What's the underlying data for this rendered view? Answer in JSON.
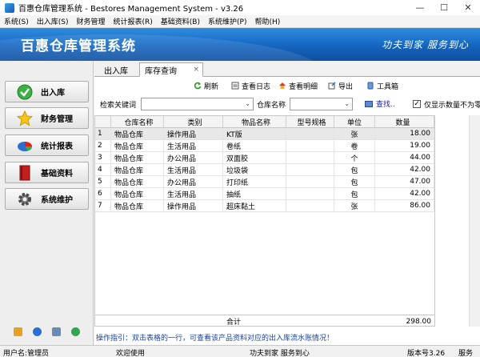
{
  "window": {
    "title": "百惠仓库管理系统 - Bestores Management System - v3.26",
    "controls": [
      "—",
      "☐",
      "✕"
    ]
  },
  "menu": [
    "系统(S)",
    "出入库(S)",
    "财务管理",
    "统计报表(R)",
    "基础资料(B)",
    "系统维护(P)",
    "帮助(H)"
  ],
  "banner": {
    "title": "百惠仓库管理系统",
    "slogan": "功夫到家 服务到心"
  },
  "sidebar": {
    "items": [
      {
        "label": "出入库",
        "icon": "check-circle-icon"
      },
      {
        "label": "财务管理",
        "icon": "star-icon"
      },
      {
        "label": "统计报表",
        "icon": "pie-chart-icon"
      },
      {
        "label": "基础资料",
        "icon": "book-icon"
      },
      {
        "label": "系统维护",
        "icon": "gear-icon"
      }
    ]
  },
  "tabs": {
    "in_out": "出入库",
    "stock_query": "库存查询",
    "close": "×"
  },
  "toolbar": {
    "refresh": "刷新",
    "view_log": "查看日志",
    "view_detail": "查看明细",
    "export": "导出",
    "toolbox": "工具箱"
  },
  "search": {
    "keyword_label": "检索关键词",
    "keyword_value": "",
    "warehouse_label": "仓库名称",
    "warehouse_value": "",
    "find_label": "查找..",
    "only_nonzero_label": "仅显示数量不为零",
    "only_nonzero_checked": "✓"
  },
  "table": {
    "headers": [
      "",
      "仓库名称",
      "类别",
      "物品名称",
      "型号规格",
      "单位",
      "数量"
    ],
    "rows": [
      [
        "1",
        "物品仓库",
        "操作用品",
        "KT版",
        "",
        "张",
        "18.00"
      ],
      [
        "2",
        "物品仓库",
        "生活用品",
        "卷纸",
        "",
        "卷",
        "19.00"
      ],
      [
        "3",
        "物品仓库",
        "办公用品",
        "双面胶",
        "",
        "个",
        "44.00"
      ],
      [
        "4",
        "物品仓库",
        "生活用品",
        "垃圾袋",
        "",
        "包",
        "42.00"
      ],
      [
        "5",
        "物品仓库",
        "办公用品",
        "打印纸",
        "",
        "包",
        "47.00"
      ],
      [
        "6",
        "物品仓库",
        "生活用品",
        "抽纸",
        "",
        "包",
        "42.00"
      ],
      [
        "7",
        "物品仓库",
        "操作用品",
        "超床黏土",
        "",
        "张",
        "86.00"
      ]
    ],
    "total_label": "合计",
    "total_value": "298.00"
  },
  "hint": "操作指引：双击表格的一行，可查看该产品资料对应的出入库流水账情况！",
  "status": {
    "user": "用户名:管理员",
    "welcome": "欢迎使用",
    "slogan": "功夫到家 服务到心",
    "version": "版本号3.26",
    "extra": "服务"
  },
  "colors": {
    "banner_blue": "#1565c0",
    "hint_blue": "#1a3fa0"
  }
}
